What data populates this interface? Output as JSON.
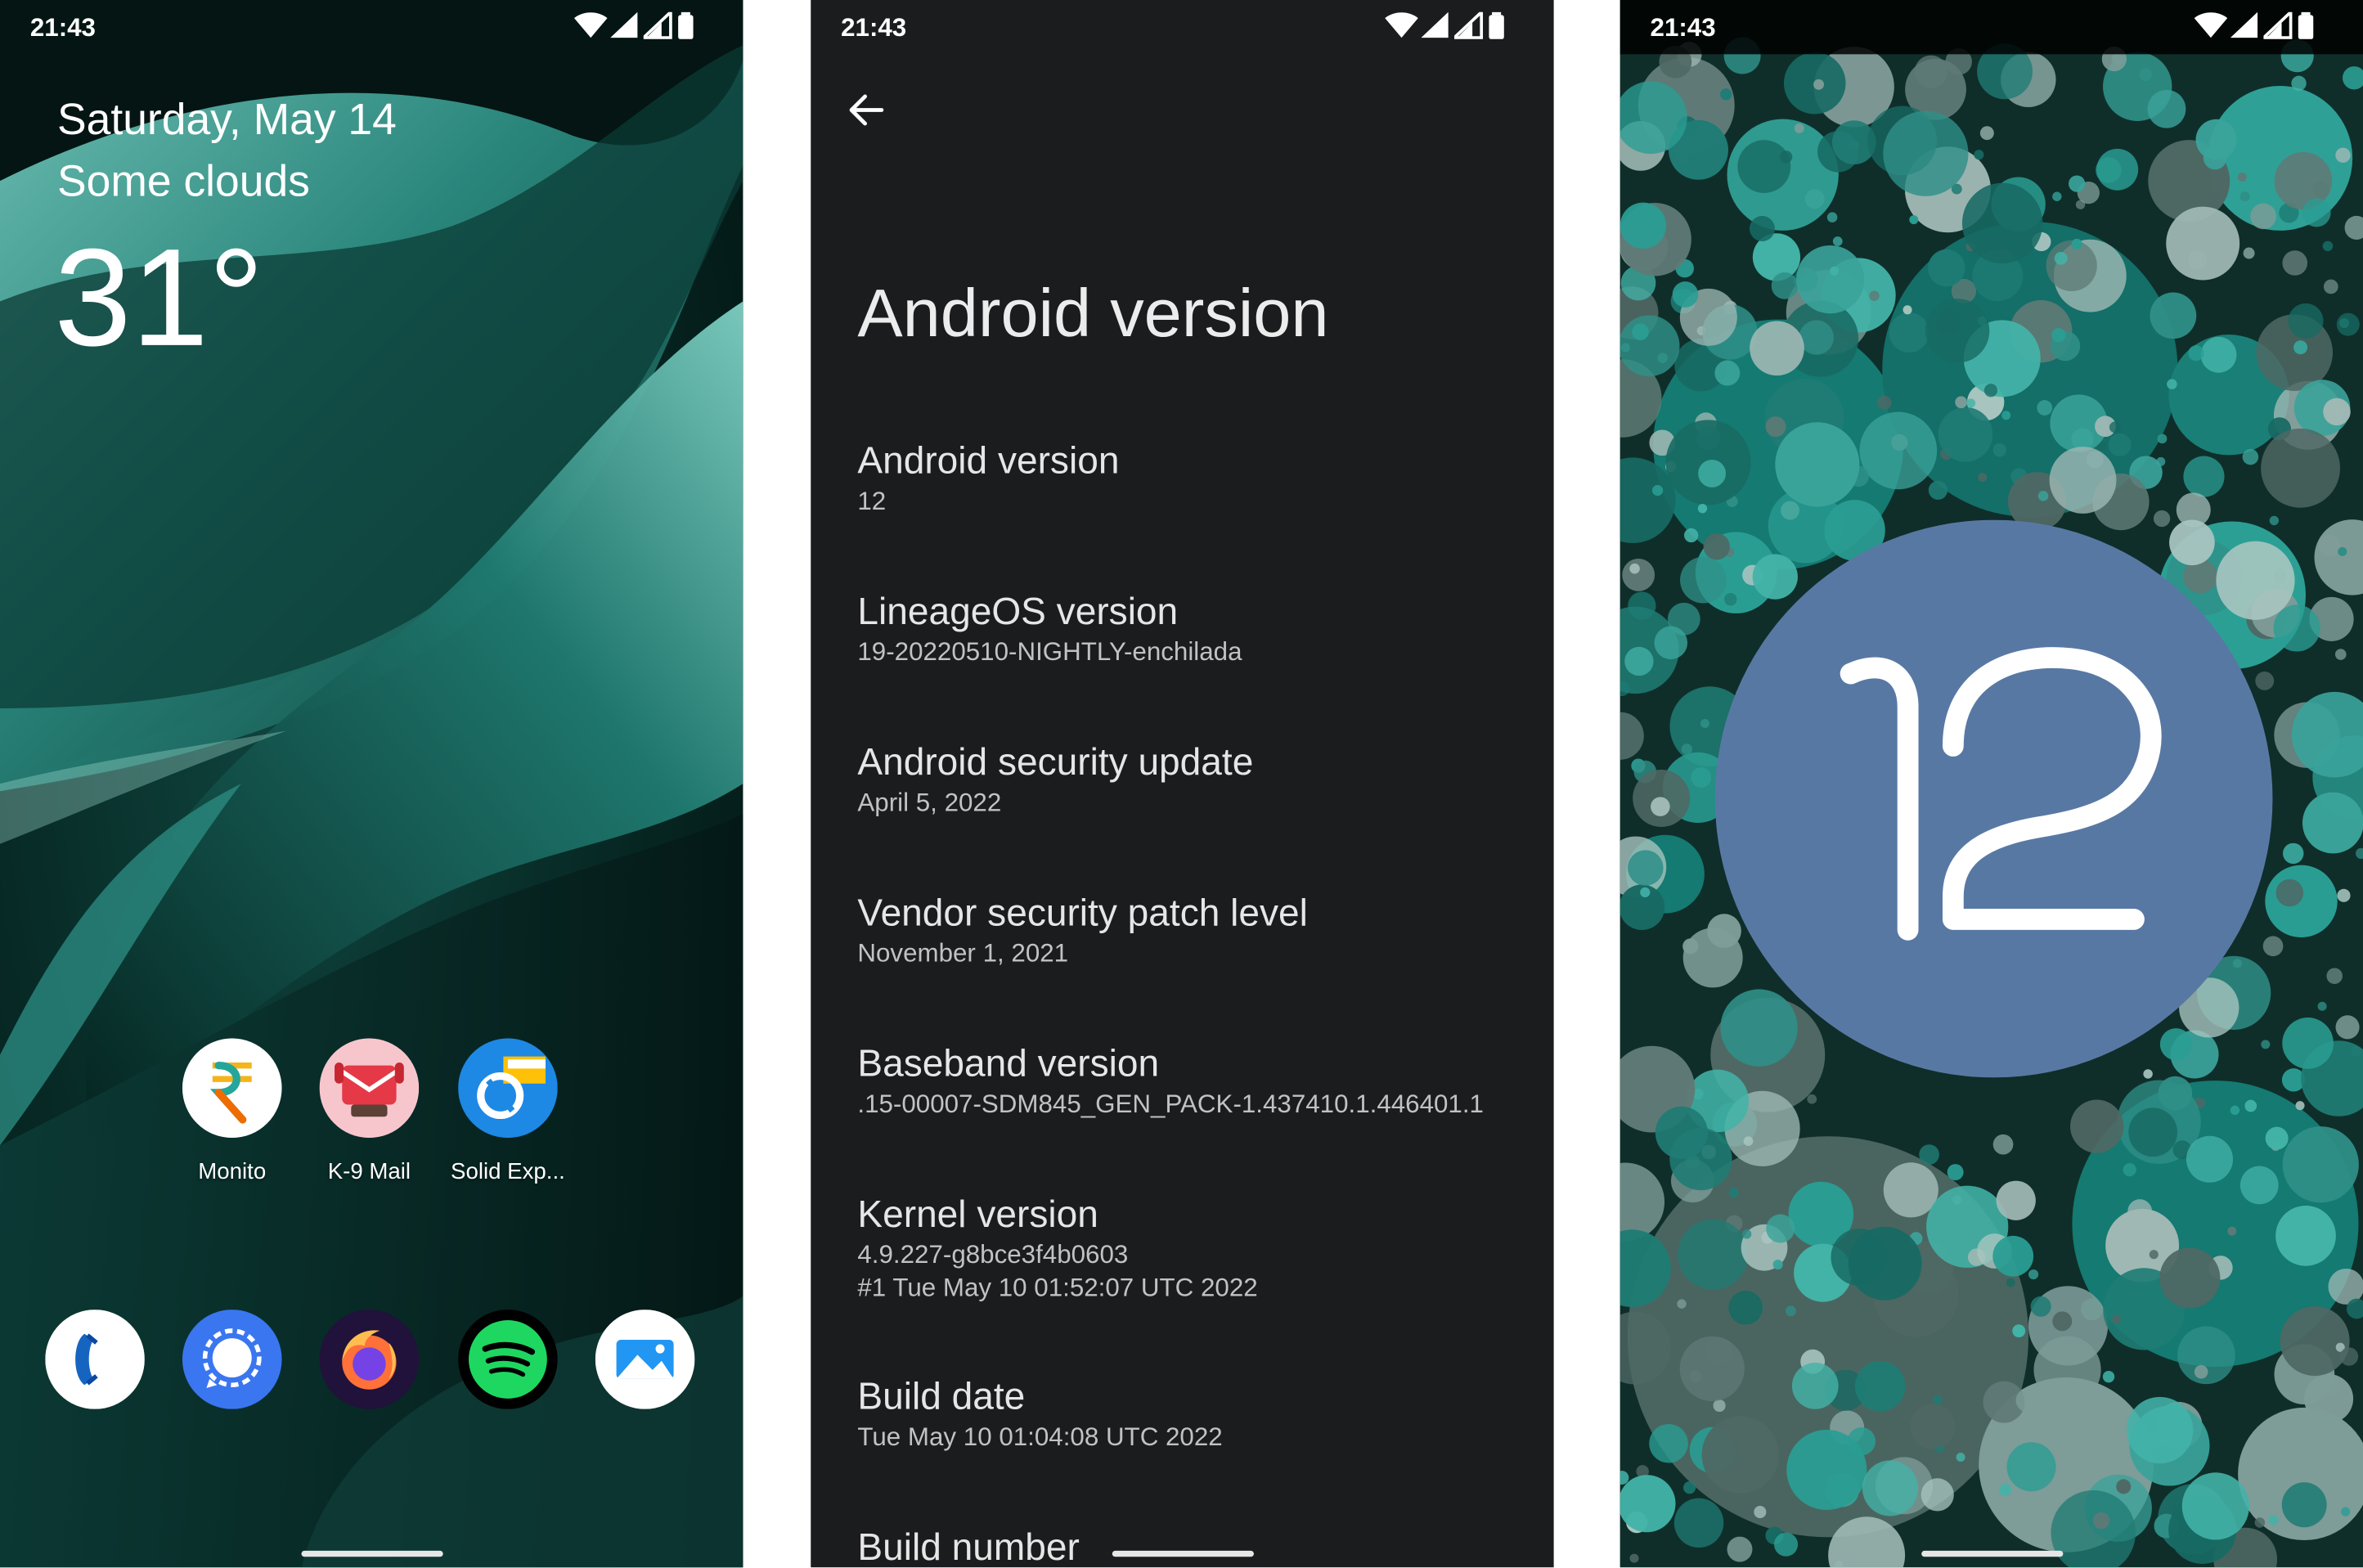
{
  "home": {
    "time": "21:43",
    "date": "Saturday, May 14",
    "weather": "Some clouds",
    "temperature": "31°",
    "apps": [
      {
        "label": "Monito",
        "icon": "rupee-icon"
      },
      {
        "label": "K-9 Mail",
        "icon": "k9-mail-icon"
      },
      {
        "label": "Solid Exp...",
        "icon": "solid-explorer-icon"
      }
    ],
    "dock": [
      {
        "icon": "phone-icon"
      },
      {
        "icon": "signal-icon"
      },
      {
        "icon": "firefox-icon"
      },
      {
        "icon": "spotify-icon"
      },
      {
        "icon": "gallery-icon"
      }
    ]
  },
  "settings": {
    "time": "21:43",
    "title": "Android version",
    "items": [
      {
        "title": "Android version",
        "summary": "12"
      },
      {
        "title": "LineageOS version",
        "summary": "19-20220510-NIGHTLY-enchilada"
      },
      {
        "title": "Android security update",
        "summary": "April 5, 2022"
      },
      {
        "title": "Vendor security patch level",
        "summary": "November 1, 2021"
      },
      {
        "title": "Baseband version",
        "summary": ".15-00007-SDM845_GEN_PACK-1.437410.1.446401.1"
      },
      {
        "title": "Kernel version",
        "summary": "4.9.227-g8bce3f4b0603",
        "summary2": "#1 Tue May 10 01:52:07 UTC 2022"
      },
      {
        "title": "Build date",
        "summary": "Tue May 10 01:04:08 UTC 2022"
      },
      {
        "title": "Build number",
        "summary": ""
      }
    ]
  },
  "easter_egg": {
    "time": "21:43",
    "version_number": "12"
  },
  "colors": {
    "settings_bg": "#1b1c1e",
    "teal": "#3a9f96",
    "logo_blue": "#5878a4"
  }
}
